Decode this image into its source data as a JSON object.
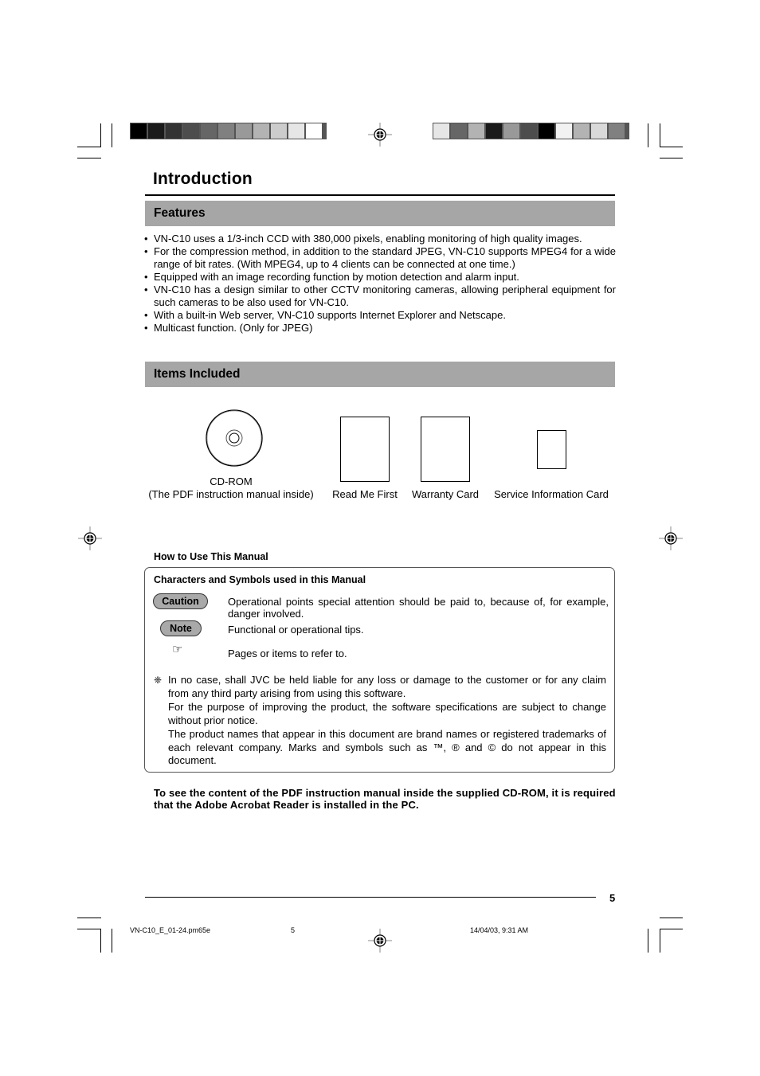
{
  "page_title": "Introduction",
  "colors": {
    "section_band": "#a6a6a6",
    "pill_fill": "#a9a9a9",
    "left_color_bar": [
      "#000000",
      "#1a1a1a",
      "#333333",
      "#4d4d4d",
      "#666666",
      "#808080",
      "#999999",
      "#b3b3b3",
      "#cccccc",
      "#e6e6e6",
      "#ffffff"
    ],
    "right_color_bar": [
      "#e6e6e6",
      "#666666",
      "#b3b3b3",
      "#1a1a1a",
      "#999999",
      "#4d4d4d",
      "#000000",
      "#f2f2f2",
      "#b3b3b3",
      "#d9d9d9",
      "#808080"
    ]
  },
  "features": {
    "heading": "Features",
    "items": [
      "VN-C10 uses a 1/3-inch CCD with 380,000 pixels, enabling monitoring of high quality images.",
      "For the compression method, in addition to the standard JPEG, VN-C10 supports MPEG4 for a wide range of bit rates. (With MPEG4, up to 4 clients can be connected at one time.)",
      "Equipped with an image recording function by motion detection and alarm input.",
      "VN-C10 has a design similar to other CCTV monitoring cameras, allowing peripheral equipment for such cameras to be also used for VN-C10.",
      "With a built-in Web server, VN-C10 supports Internet Explorer and Netscape.",
      "Multicast function. (Only for JPEG)"
    ]
  },
  "items_included": {
    "heading": "Items Included",
    "items": [
      {
        "icon": "cd-rom-icon",
        "label_line1": "CD-ROM",
        "label_line2": "(The PDF instruction manual inside)"
      },
      {
        "icon": "document-icon",
        "label_line1": "Read Me First"
      },
      {
        "icon": "document-icon",
        "label_line1": "Warranty Card"
      },
      {
        "icon": "card-icon",
        "label_line1": "Service Information Card"
      }
    ]
  },
  "how_to_use": {
    "label": "How to Use This Manual",
    "box_heading": "Characters and Symbols used in this Manual",
    "symbols": [
      {
        "badge": "Caution",
        "text": "Operational points special attention should be paid to, because of, for example, danger involved."
      },
      {
        "badge": "Note",
        "text": "Functional or operational tips."
      },
      {
        "icon": "pointing-hand-icon",
        "glyph": "☞",
        "text": "Pages or items to refer to."
      }
    ],
    "asterisk_glyph": "❈",
    "notes": [
      "In no case, shall JVC be held liable for any loss or damage to the customer or for any claim from any third party arising from using this software.",
      "For the purpose of improving the product, the software specifications are subject to change without prior notice.",
      "The product names that appear in this document are brand names or registered trademarks of each relevant company. Marks and symbols such as ™, ® and © do not appear in this document."
    ]
  },
  "acrobat_note": "To see the content of the PDF instruction manual inside the supplied CD-ROM, it is required that the Adobe Acrobat Reader is installed in the PC.",
  "footer": {
    "page_number": "5",
    "slug_file": "VN-C10_E_01-24.pm65e",
    "slug_page": "5",
    "slug_date": "14/04/03, 9:31 AM"
  }
}
